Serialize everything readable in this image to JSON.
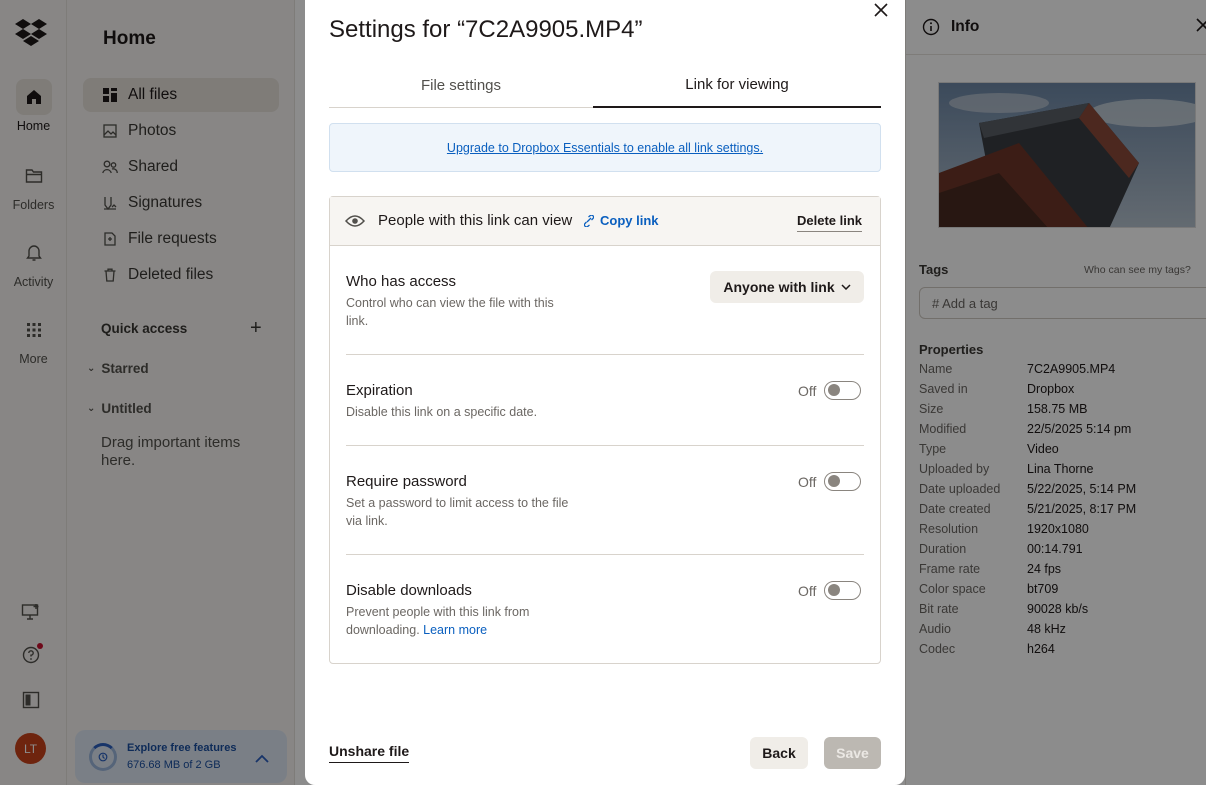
{
  "rail": {
    "items": [
      {
        "label": "Home",
        "icon": "home-icon"
      },
      {
        "label": "Folders",
        "icon": "folder-icon"
      },
      {
        "label": "Activity",
        "icon": "bell-icon"
      },
      {
        "label": "More",
        "icon": "grid-icon"
      }
    ],
    "avatar_initials": "LT"
  },
  "sidebar": {
    "title": "Home",
    "items": [
      {
        "label": "All files",
        "icon": "all-files-icon"
      },
      {
        "label": "Photos",
        "icon": "photos-icon"
      },
      {
        "label": "Shared",
        "icon": "shared-icon"
      },
      {
        "label": "Signatures",
        "icon": "signature-icon"
      },
      {
        "label": "File requests",
        "icon": "file-request-icon"
      },
      {
        "label": "Deleted files",
        "icon": "trash-icon"
      }
    ],
    "quick_access": "Quick access",
    "starred": "Starred",
    "untitled": "Untitled",
    "drag_hint": "Drag important items here.",
    "promo": {
      "title": "Explore free features",
      "storage": "676.68 MB of 2 GB"
    }
  },
  "modal": {
    "title": "Settings for “7C2A9905.MP4”",
    "tabs": [
      "File settings",
      "Link for viewing"
    ],
    "upgrade_link": "Upgrade to Dropbox Essentials to enable all link settings.",
    "link_head": "People with this link can view",
    "copy_link": "Copy link",
    "delete_link": "Delete link",
    "access": {
      "title": "Who has access",
      "desc": "Control who can view the file with this link.",
      "value": "Anyone with link"
    },
    "expiration": {
      "title": "Expiration",
      "desc": "Disable this link on a specific date.",
      "state": "Off"
    },
    "password": {
      "title": "Require password",
      "desc": "Set a password to limit access to the file via link.",
      "state": "Off"
    },
    "downloads": {
      "title": "Disable downloads",
      "desc": "Prevent people with this link from downloading.",
      "learn_more": "Learn more",
      "state": "Off"
    },
    "unshare": "Unshare file",
    "back": "Back",
    "save": "Save"
  },
  "info": {
    "title": "Info",
    "tags_label": "Tags",
    "tags_who": "Who can see my tags?",
    "tag_placeholder": "# Add a tag",
    "properties_title": "Properties",
    "properties": [
      {
        "k": "Name",
        "v": "7C2A9905.MP4"
      },
      {
        "k": "Saved in",
        "v": "Dropbox"
      },
      {
        "k": "Size",
        "v": "158.75 MB"
      },
      {
        "k": "Modified",
        "v": "22/5/2025 5:14 pm"
      },
      {
        "k": "Type",
        "v": "Video"
      },
      {
        "k": "Uploaded by",
        "v": "Lina Thorne"
      },
      {
        "k": "Date uploaded",
        "v": "5/22/2025, 5:14 PM"
      },
      {
        "k": "Date created",
        "v": "5/21/2025, 8:17 PM"
      },
      {
        "k": "Resolution",
        "v": "1920x1080"
      },
      {
        "k": "Duration",
        "v": "00:14.791"
      },
      {
        "k": "Frame rate",
        "v": "24 fps"
      },
      {
        "k": "Color space",
        "v": "bt709"
      },
      {
        "k": "Bit rate",
        "v": "90028 kb/s"
      },
      {
        "k": "Audio",
        "v": "48 kHz"
      },
      {
        "k": "Codec",
        "v": "h264"
      }
    ]
  },
  "colors": {
    "accent": "#0a5fbf",
    "overlay": "rgba(0,0,0,0.45)",
    "avatar": "#c9421b"
  }
}
